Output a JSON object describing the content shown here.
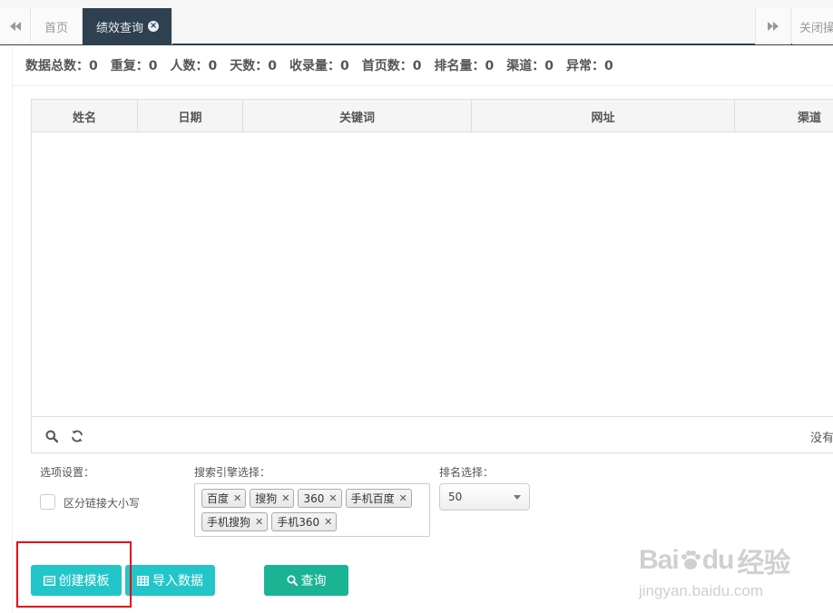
{
  "tabs": {
    "items": [
      "首页",
      "绩效查询"
    ],
    "active_index": 1,
    "close_ops_label": "关闭操作"
  },
  "stats": [
    {
      "label": "数据总数：",
      "value": "0"
    },
    {
      "label": "重复：",
      "value": "0"
    },
    {
      "label": "人数：",
      "value": "0"
    },
    {
      "label": "天数：",
      "value": "0"
    },
    {
      "label": "收录量：",
      "value": "0"
    },
    {
      "label": "首页数：",
      "value": "0"
    },
    {
      "label": "排名量：",
      "value": "0"
    },
    {
      "label": "渠道：",
      "value": "0"
    },
    {
      "label": "异常：",
      "value": "0"
    }
  ],
  "table": {
    "columns": [
      "姓名",
      "日期",
      "关键词",
      "网址",
      "渠道"
    ],
    "rows": [],
    "empty_text": "没有"
  },
  "options": {
    "label": "选项设置：",
    "case_checkbox_label": "区分链接大小写",
    "case_checked": false
  },
  "engines": {
    "label": "搜索引擎选择：",
    "selected": [
      "百度",
      "搜狗",
      "360",
      "手机百度",
      "手机搜狗",
      "手机360"
    ]
  },
  "rank": {
    "label": "排名选择：",
    "value": "50"
  },
  "buttons": {
    "create_template": "创建模板",
    "import_data": "导入数据",
    "query": "查询"
  },
  "colors": {
    "tab_active": "#2f4050",
    "button_info": "#23c6c8",
    "button_primary": "#1ab394",
    "highlight": "#e60012"
  },
  "watermark": {
    "brand": "Bai",
    "brand2": "du",
    "cn": "经验",
    "url": "jingyan.baidu.com"
  }
}
